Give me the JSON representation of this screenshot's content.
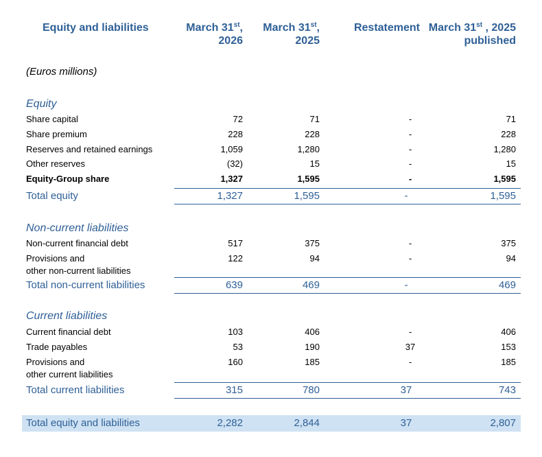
{
  "header": {
    "label": "Equity and liabilities",
    "col1": {
      "pre": "March 31",
      "sup": "st",
      "post": ",",
      "line2": "2026"
    },
    "col2": {
      "pre": "March 31",
      "sup": "st",
      "post": ",",
      "line2": "2025"
    },
    "col3": {
      "text": "Restatement"
    },
    "col4": {
      "pre": "March 31",
      "sup": "st",
      "post": " , 2025",
      "line2": "published"
    }
  },
  "units": "(Euros millions)",
  "equity": {
    "title": "Equity",
    "rows": [
      {
        "label": "Share capital",
        "v1": "72",
        "v2": "71",
        "v3": "-",
        "v4": "71"
      },
      {
        "label": "Share premium",
        "v1": "228",
        "v2": "228",
        "v3": "-",
        "v4": "228"
      },
      {
        "label": "Reserves and retained earnings",
        "v1": "1,059",
        "v2": "1,280",
        "v3": "-",
        "v4": "1,280"
      },
      {
        "label": "Other reserves",
        "v1": "(32)",
        "v2": "15",
        "v3": "-",
        "v4": "15"
      },
      {
        "label": "Equity-Group share",
        "v1": "1,327",
        "v2": "1,595",
        "v3": "-",
        "v4": "1,595"
      }
    ],
    "total": {
      "label": "Total equity",
      "v1": "1,327",
      "v2": "1,595",
      "v3": "-",
      "v4": "1,595"
    }
  },
  "noncurrent": {
    "title": "Non-current liabilities",
    "rows": [
      {
        "label": "Non-current financial debt",
        "v1": "517",
        "v2": "375",
        "v3": "-",
        "v4": "375"
      },
      {
        "label": "Provisions and",
        "label2": "other non-current liabilities",
        "v1": "122",
        "v2": "94",
        "v3": "-",
        "v4": "94"
      }
    ],
    "total": {
      "label": "Total non-current liabilities",
      "v1": "639",
      "v2": "469",
      "v3": "-",
      "v4": "469"
    }
  },
  "current": {
    "title": "Current liabilities",
    "rows": [
      {
        "label": "Current financial debt",
        "v1": "103",
        "v2": "406",
        "v3": "-",
        "v4": "406"
      },
      {
        "label": "Trade payables",
        "v1": "53",
        "v2": "190",
        "v3": "37",
        "v4": "153"
      },
      {
        "label": "Provisions and",
        "label2": "other current liabilities",
        "v1": "160",
        "v2": "185",
        "v3": "-",
        "v4": "185"
      }
    ],
    "total": {
      "label": "Total current liabilities",
      "v1": "315",
      "v2": "780",
      "v3": "37",
      "v4": "743"
    }
  },
  "grand_total": {
    "label": "Total equity and liabilities",
    "v1": "2,282",
    "v2": "2,844",
    "v3": "37",
    "v4": "2,807"
  },
  "colors": {
    "accent": "#2e5f96",
    "highlight": "#cfe2f3"
  }
}
